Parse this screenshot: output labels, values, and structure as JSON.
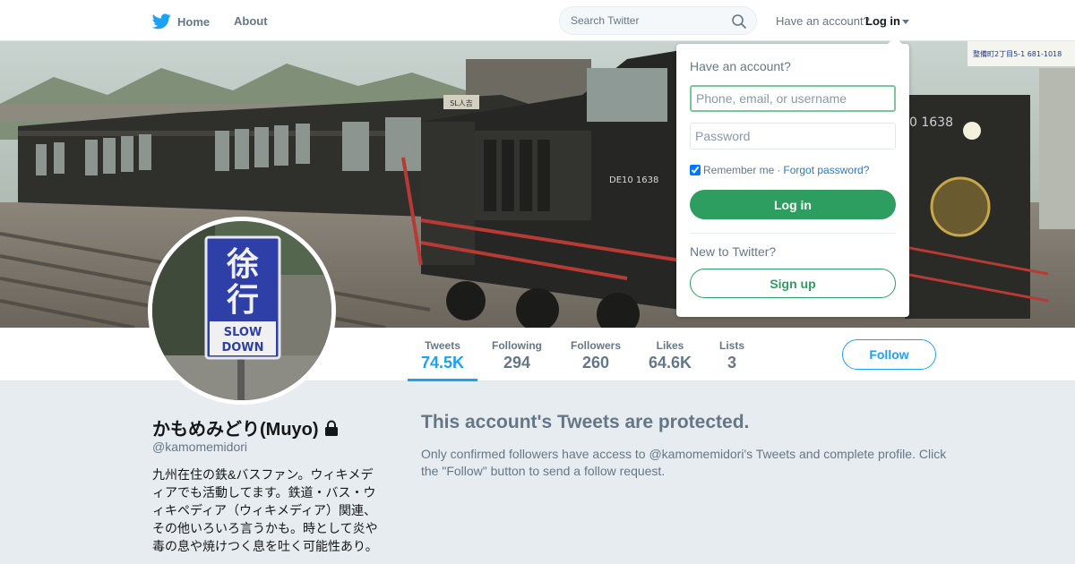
{
  "nav": {
    "home_label": "Home",
    "about_label": "About",
    "search_placeholder": "Search Twitter",
    "have_account_label": "Have an account?",
    "login_label": "Log in",
    "brand_color": "#1da1f2"
  },
  "avatar_sign": {
    "line1": "徐",
    "line2": "行",
    "line3": "SLOW",
    "line4": "DOWN"
  },
  "banner_signs": {
    "sl_plate": "SL人吉",
    "loco_number": "DE10 1638",
    "loco_number_right": "0 1638",
    "shop_sign": "整備町2丁目5-1 681-1018"
  },
  "stats": [
    {
      "label": "Tweets",
      "value": "74.5K",
      "active": true
    },
    {
      "label": "Following",
      "value": "294",
      "active": false
    },
    {
      "label": "Followers",
      "value": "260",
      "active": false
    },
    {
      "label": "Likes",
      "value": "64.6K",
      "active": false
    },
    {
      "label": "Lists",
      "value": "3",
      "active": false
    }
  ],
  "follow_button_label": "Follow",
  "profile": {
    "name": "かもめみどり(Muyo)",
    "handle": "@kamomemidori",
    "bio": "九州在住の鉄&バスファン。ウィキメディアでも活動してます。鉄道・バス・ウィキペディア（ウィキメディア）関連、その他いろいろ言うかも。時として炎や毒の息や焼けつく息を吐く可能性あり。"
  },
  "protected": {
    "title": "This account's Tweets are protected.",
    "text": "Only confirmed followers have access to @kamomemidori's Tweets and complete profile. Click the \"Follow\" button to send a follow request."
  },
  "login_dropdown": {
    "title": "Have an account?",
    "username_placeholder": "Phone, email, or username",
    "password_placeholder": "Password",
    "remember_label": "Remember me",
    "separator": "·",
    "forgot_label": "Forgot password?",
    "remember_checked": true,
    "login_button": "Log in",
    "new_label": "New to Twitter?",
    "signup_button": "Sign up",
    "accent_color": "#2d9e5f"
  }
}
